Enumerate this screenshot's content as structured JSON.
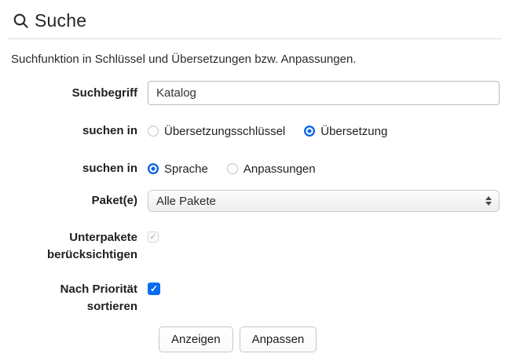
{
  "header": {
    "title": "Suche"
  },
  "subtitle": "Suchfunktion in Schlüssel und Übersetzungen bzw. Anpassungen.",
  "form": {
    "suchbegriff": {
      "label": "Suchbegriff",
      "value": "Katalog"
    },
    "suchen_in_1": {
      "label": "suchen in",
      "options": [
        {
          "label": "Übersetzungsschlüssel",
          "selected": false
        },
        {
          "label": "Übersetzung",
          "selected": true
        }
      ]
    },
    "suchen_in_2": {
      "label": "suchen in",
      "options": [
        {
          "label": "Sprache",
          "selected": true
        },
        {
          "label": "Anpassungen",
          "selected": false
        }
      ]
    },
    "pakete": {
      "label": "Paket(e)",
      "selected_value": "Alle Pakete"
    },
    "unterpakete": {
      "label_line1": "Unterpakete",
      "label_line2": "berücksichtigen",
      "checked": true,
      "disabled": true,
      "check_glyph": "✓"
    },
    "prioritaet": {
      "label_line1": "Nach Priorität",
      "label_line2": "sortieren",
      "checked": true,
      "disabled": false,
      "check_glyph": "✓"
    }
  },
  "buttons": {
    "anzeigen": "Anzeigen",
    "anpassen": "Anpassen"
  },
  "colors": {
    "accent_blue": "#0a6cf0",
    "divider": "#dcdcdc",
    "input_border": "#b9b9b9"
  }
}
